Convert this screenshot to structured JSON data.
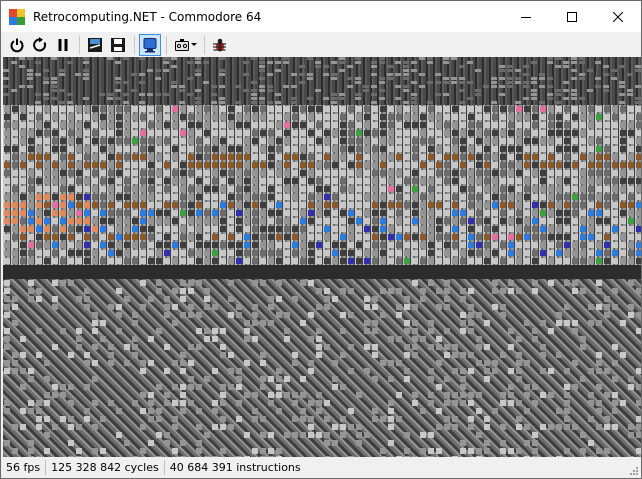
{
  "window": {
    "title": "Retrocomputing.NET - Commodore 64",
    "controls": [
      "minimize",
      "maximize",
      "close"
    ]
  },
  "toolbar": {
    "buttons": [
      {
        "icon": "power-icon"
      },
      {
        "icon": "reset-icon"
      },
      {
        "icon": "pause-icon"
      },
      {
        "icon": "load-disk-icon"
      },
      {
        "icon": "save-disk-icon"
      },
      {
        "icon": "monitor-icon",
        "active": true
      },
      {
        "icon": "tape-icon",
        "dropdown": true
      },
      {
        "icon": "debug-bug-icon"
      }
    ]
  },
  "screen": {
    "palette": [
      "#3e3e3e",
      "#6c6c6c",
      "#959595",
      "#c8c8c8",
      "#8b5a2b",
      "#e08a5f",
      "#2d7be0",
      "#3030b0",
      "#40a040",
      "#e070a0"
    ]
  },
  "status": {
    "fps": "56 fps",
    "cycles": "125 328 842 cycles",
    "instructions": "40 684 391 instructions"
  }
}
